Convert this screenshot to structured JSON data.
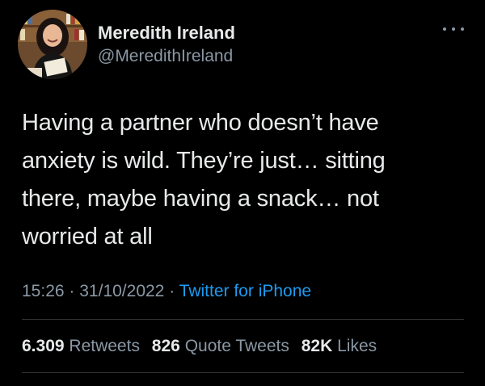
{
  "user": {
    "display_name": "Meredith Ireland",
    "handle": "@MeredithIreland",
    "avatar_icon": "profile-photo"
  },
  "more_icon": "ellipsis-icon",
  "tweet": {
    "lines": [
      "Having a partner who doesn’t have",
      "anxiety is wild. They’re just… sitting",
      "there, maybe having a snack… not",
      "worried at all"
    ]
  },
  "meta": {
    "time": "15:26",
    "date": "31/10/2022",
    "separator": "·",
    "source": "Twitter for iPhone"
  },
  "stats": {
    "retweets": {
      "count": "6.309",
      "label": "Retweets"
    },
    "quotes": {
      "count": "826",
      "label": "Quote Tweets"
    },
    "likes": {
      "count": "82K",
      "label": "Likes"
    }
  },
  "colors": {
    "background": "#000000",
    "text": "#e7e9ea",
    "secondary": "#8b98a5",
    "link": "#1d9bf0",
    "divider": "#2f3336"
  }
}
